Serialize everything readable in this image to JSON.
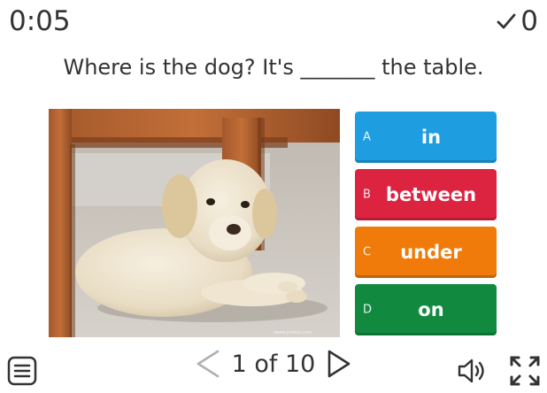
{
  "header": {
    "timer": "0:05",
    "score": "0",
    "check_icon": "checkmark-icon"
  },
  "question": {
    "text": "Where is the dog? It's _______ the table."
  },
  "image": {
    "description_icon": "puppy-under-table-photo",
    "watermark": "www.photos.com"
  },
  "options": [
    {
      "letter": "A",
      "label": "in",
      "color": "#1e9ee0"
    },
    {
      "letter": "B",
      "label": "between",
      "color": "#dc2340"
    },
    {
      "letter": "C",
      "label": "under",
      "color": "#f07b0a"
    },
    {
      "letter": "D",
      "label": "on",
      "color": "#118a3f"
    }
  ],
  "footer": {
    "page_label": "1 of 10",
    "menu_icon": "menu-icon",
    "prev_icon": "previous-arrow-icon",
    "next_icon": "next-arrow-icon",
    "sound_icon": "speaker-icon",
    "fullscreen_icon": "fullscreen-icon"
  }
}
